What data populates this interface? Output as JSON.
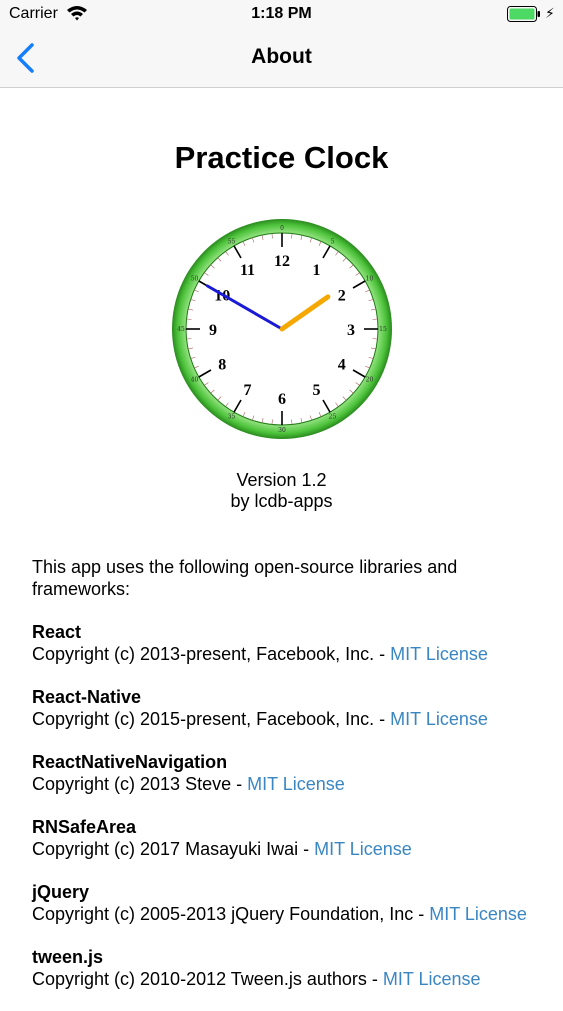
{
  "status_bar": {
    "carrier": "Carrier",
    "time": "1:18 PM"
  },
  "nav": {
    "title": "About"
  },
  "app": {
    "title": "Practice Clock",
    "version": "Version 1.2",
    "author": "by lcdb-apps"
  },
  "intro": "This app uses the following open-source libraries and frameworks:",
  "libraries": [
    {
      "name": "React",
      "copyright": "Copyright (c) 2013-present, Facebook, Inc. - ",
      "license": "MIT License"
    },
    {
      "name": "React-Native",
      "copyright": "Copyright (c) 2015-present, Facebook, Inc. - ",
      "license": "MIT License"
    },
    {
      "name": "ReactNativeNavigation",
      "copyright": "Copyright (c) 2013 Steve - ",
      "license": "MIT License"
    },
    {
      "name": "RNSafeArea",
      "copyright": "Copyright (c) 2017 Masayuki Iwai - ",
      "license": "MIT License"
    },
    {
      "name": "jQuery",
      "copyright": "Copyright (c) 2005-2013 jQuery Foundation, Inc - ",
      "license": "MIT License"
    },
    {
      "name": "tween.js",
      "copyright": "Copyright (c) 2010-2012 Tween.js authors - ",
      "license": "MIT License"
    }
  ],
  "clock": {
    "hours": [
      "12",
      "1",
      "2",
      "3",
      "4",
      "5",
      "6",
      "7",
      "8",
      "9",
      "10",
      "11"
    ],
    "minutes": [
      "0",
      "5",
      "10",
      "15",
      "20",
      "25",
      "30",
      "35",
      "40",
      "45",
      "50",
      "55"
    ],
    "time_shown": "1:50",
    "colors": {
      "ring": "#4cc23a",
      "hour_hand": "#f5a800",
      "minute_hand": "#1a1ad6"
    }
  }
}
